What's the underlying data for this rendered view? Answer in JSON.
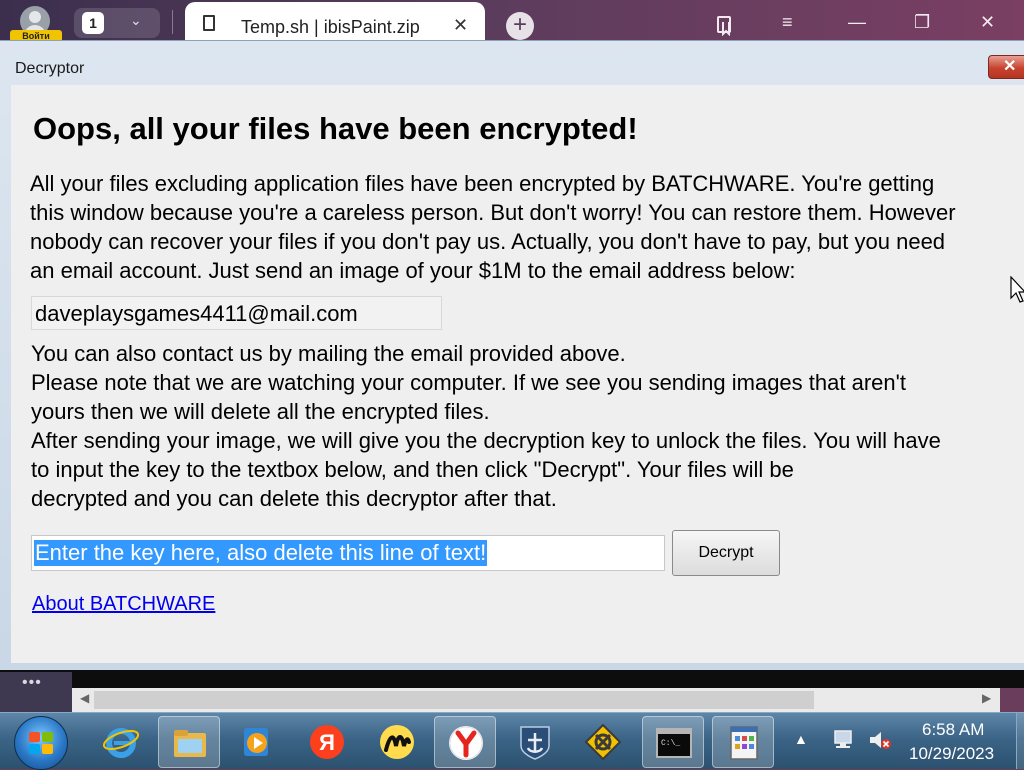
{
  "browser": {
    "profile_badge": "Войти",
    "tab_count": "1",
    "tab_title": "Temp.sh | ibisPaint.zip",
    "new_tab_symbol": "+",
    "controls": {
      "bookmarks": "bookmarks-icon",
      "menu": "≡",
      "minimize": "—",
      "restore": "❐",
      "close": "✕"
    }
  },
  "window": {
    "title": "Decryptor",
    "close_symbol": "✕",
    "headline": "Oops, all your files have been encrypted!",
    "intro_lines": [
      "All your files excluding application files have been encrypted by BATCHWARE. You're getting",
      "this window because you're a careless person. But don't worry! You can restore them. However",
      "nobody can recover your files if you don't pay us. Actually, you don't have to pay, but you need",
      "an email account. Just send an image of your $1M to the email address below:"
    ],
    "email": "daveplaysgames4411@mail.com",
    "body_lines": [
      "You can also contact us by mailing the email provided above.",
      "Please note that we are watching your computer. If we see you sending images that aren't",
      "yours then we will delete all the encrypted files.",
      "After sending your image, we will give you the decryption key to unlock the files. You will have",
      "to input the key to the textbox below, and then click \"Decrypt\". Your files will be",
      "decrypted and you can delete this decryptor after that."
    ],
    "key_input_value": "Enter the key here, also delete this line of text!",
    "decrypt_label": "Decrypt",
    "about_link": "About BATCHWARE"
  },
  "below": {
    "dots": "•••"
  },
  "taskbar": {
    "items": [
      "start-orb",
      "internet-explorer",
      "file-explorer",
      "media-player",
      "yandex",
      "yandex-music",
      "yandex-browser",
      "world-of-warships",
      "game-icon",
      "command-prompt",
      "control-panel-window"
    ],
    "clock_time": "6:58 AM",
    "clock_date": "10/29/2023"
  }
}
